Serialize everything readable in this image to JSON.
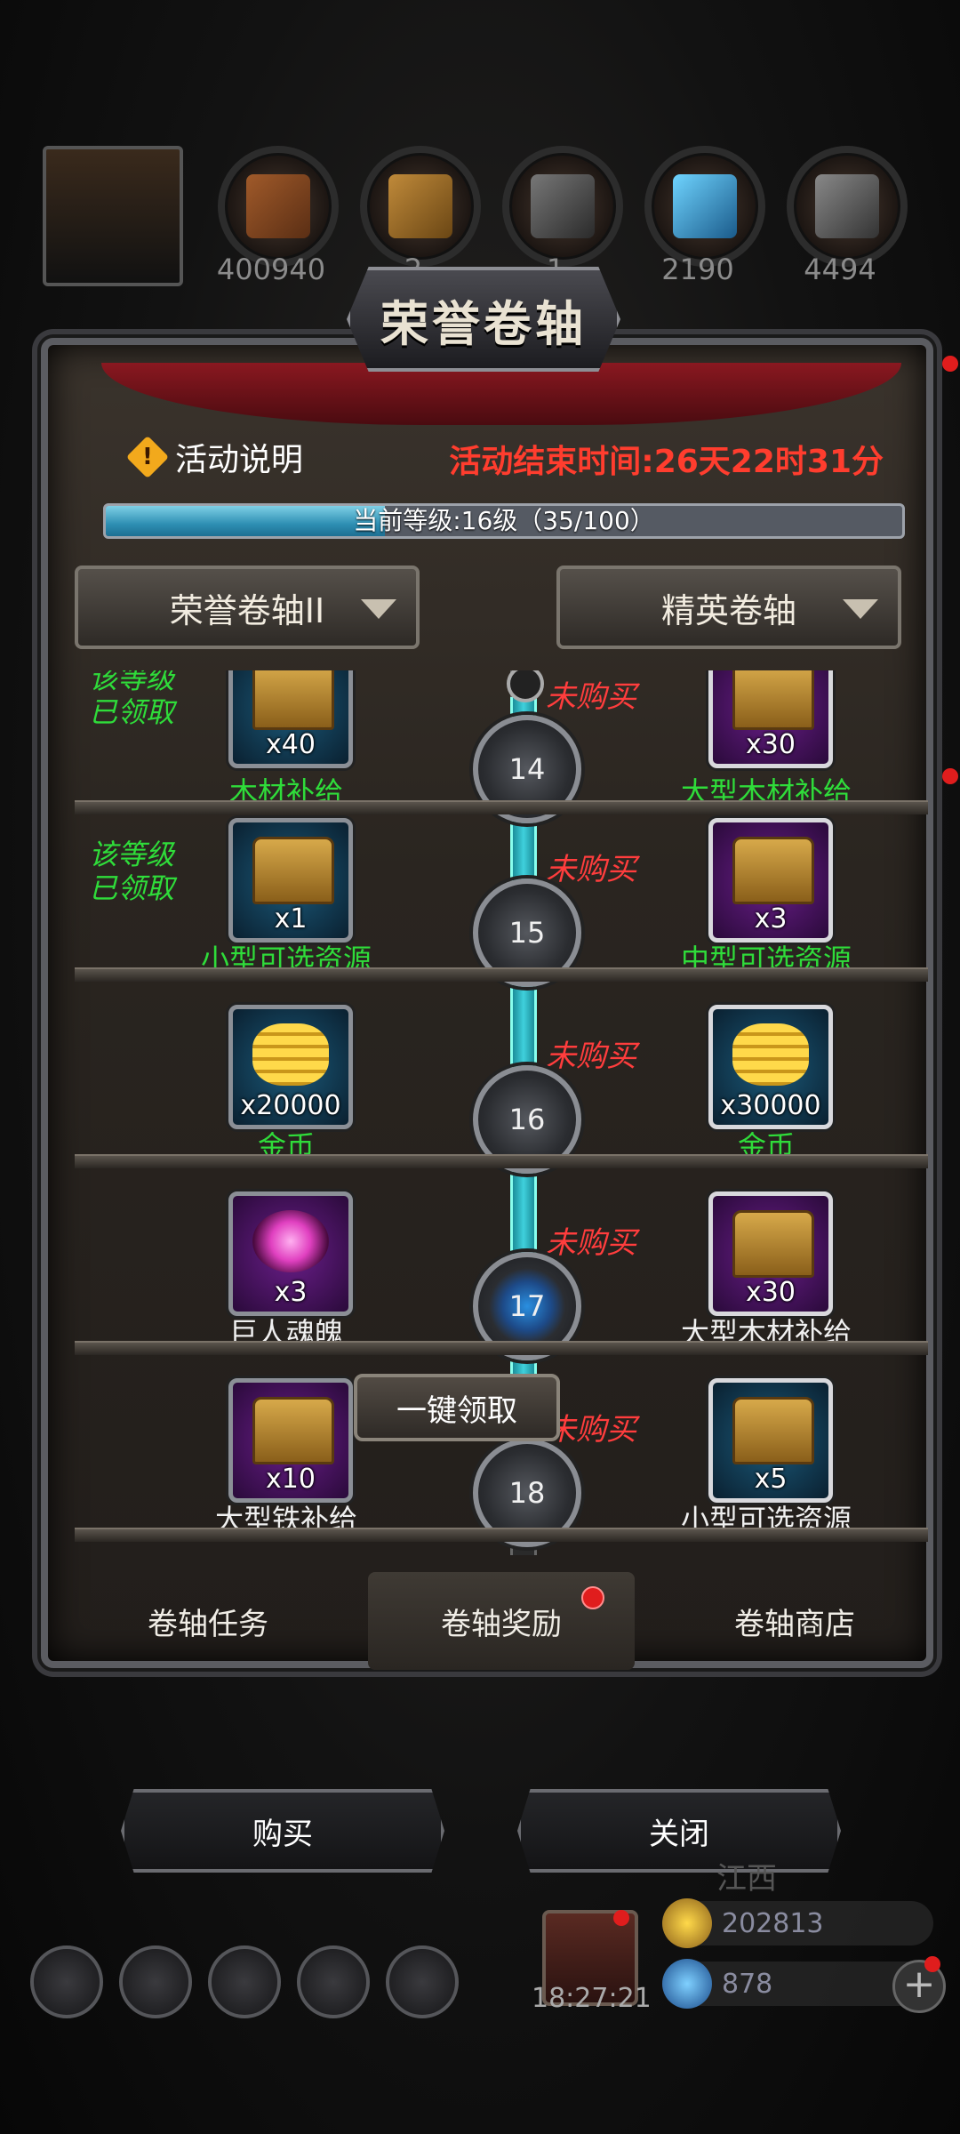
{
  "resources": [
    {
      "name": "avatar-icon",
      "value": ""
    },
    {
      "name": "wood-icon",
      "value": "400940"
    },
    {
      "name": "plank-icon",
      "value": "2"
    },
    {
      "name": "iron-icon",
      "value": "1"
    },
    {
      "name": "crystal-icon",
      "value": "2190"
    },
    {
      "name": "steel-icon",
      "value": "4494"
    }
  ],
  "panel": {
    "title": "荣誉卷轴",
    "info_label": "活动说明",
    "end_time": "活动结束时间:26天22时31分",
    "level_text": "当前等级:16级（35/100）",
    "level_progress": 0.35,
    "dropdown_left": "荣誉卷轴II",
    "dropdown_right": "精英卷轴"
  },
  "rows": [
    {
      "level": "14",
      "claimed": "该等级\n已领取",
      "left_name": "木材补给",
      "left_qty": "x40",
      "left_color": "green",
      "right_name": "大型木材补给",
      "right_qty": "x30",
      "right_status": "未购买"
    },
    {
      "level": "15",
      "claimed": "该等级\n已领取",
      "left_name": "小型可选资源",
      "left_qty": "x1",
      "left_color": "green",
      "right_name": "中型可选资源",
      "right_qty": "x3",
      "right_status": "未购买"
    },
    {
      "level": "16",
      "claimed": "",
      "left_name": "金币",
      "left_qty": "x20000",
      "left_color": "green",
      "right_name": "金币",
      "right_qty": "x30000",
      "right_status": "未购买"
    },
    {
      "level": "17",
      "claimed": "",
      "left_name": "巨人魂魄",
      "left_qty": "x3",
      "left_color": "white",
      "right_name": "大型木材补给",
      "right_qty": "x30",
      "right_status": "未购买"
    },
    {
      "level": "18",
      "claimed": "",
      "left_name": "大型铁补给",
      "left_qty": "x10",
      "left_color": "white",
      "right_name": "小型可选资源",
      "right_qty": "x5",
      "right_status": "未购买"
    }
  ],
  "tabs": [
    "卷轴任务",
    "卷轴奖励",
    "卷轴商店"
  ],
  "collect_all": "一键领取",
  "buy": "购买",
  "close": "关闭",
  "hud": {
    "clock": "18:27:21",
    "gold": "202813",
    "gems": "878",
    "faded_label": "江西"
  }
}
